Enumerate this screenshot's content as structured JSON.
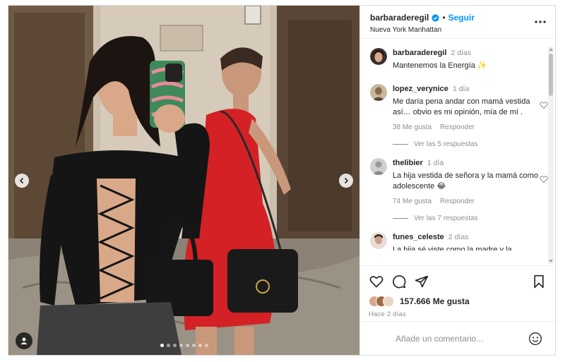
{
  "post": {
    "username": "barbaraderegil",
    "follow_label": "Seguir",
    "location": "Nueva York Manhattan",
    "caption": {
      "username": "barbaraderegil",
      "time": "2 días",
      "text": "Mantenemos la Energía ✨"
    },
    "carousel": {
      "total": 8,
      "current": 1
    },
    "likes_label": "157.666 Me gusta",
    "time_ago": "Hace 2 días"
  },
  "comments": [
    {
      "username": "lopez_verynice",
      "time": "1 día",
      "text": "Me daría pena andar con mamá vestida así… obvio es mi opinión, mía de mí .",
      "likes": "38 Me gusta",
      "reply_label": "Responder",
      "view_replies": "Ver las 5 respuestas"
    },
    {
      "username": "thelibier",
      "time": "1 día",
      "text": "La hija vestida de señora y la mamá como adolescente 😂",
      "likes": "74 Me gusta",
      "reply_label": "Responder",
      "view_replies": "Ver las 7 respuestas"
    },
    {
      "username": "funes_celeste",
      "time": "2 días",
      "text": "La hija sé viste como la madre y la"
    }
  ],
  "comment_input": {
    "placeholder": "Añade un comentario..."
  },
  "colors": {
    "accent": "#0095f6",
    "text": "#262626",
    "secondary": "#8e8e8e",
    "border": "#dbdbdb"
  },
  "icons": [
    "verified-badge-icon",
    "more-options-icon",
    "heart-icon",
    "comment-icon",
    "share-icon",
    "bookmark-icon",
    "emoji-icon",
    "chevron-left-icon",
    "chevron-right-icon",
    "user-tag-icon"
  ]
}
